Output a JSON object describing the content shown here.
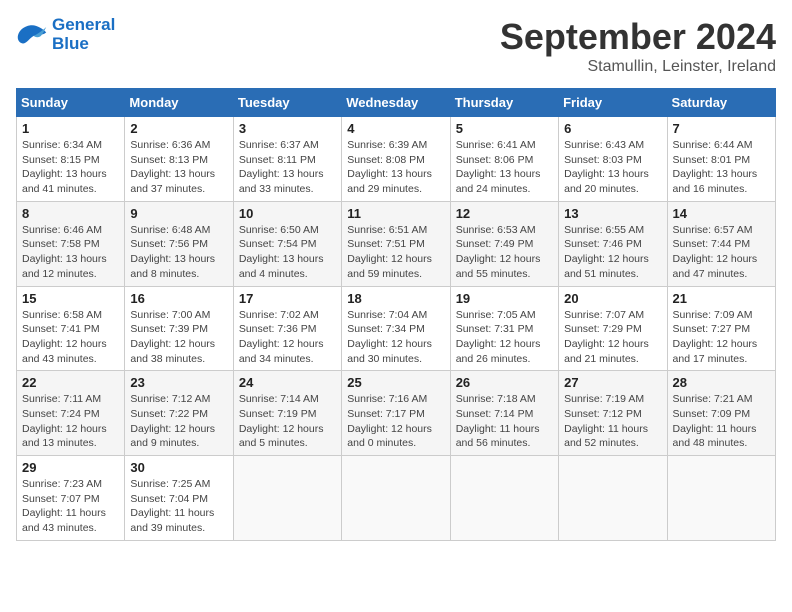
{
  "header": {
    "logo_line1": "General",
    "logo_line2": "Blue",
    "month": "September 2024",
    "location": "Stamullin, Leinster, Ireland"
  },
  "weekdays": [
    "Sunday",
    "Monday",
    "Tuesday",
    "Wednesday",
    "Thursday",
    "Friday",
    "Saturday"
  ],
  "weeks": [
    [
      {
        "num": "1",
        "rise": "6:34 AM",
        "set": "8:15 PM",
        "daylight": "13 hours and 41 minutes."
      },
      {
        "num": "2",
        "rise": "6:36 AM",
        "set": "8:13 PM",
        "daylight": "13 hours and 37 minutes."
      },
      {
        "num": "3",
        "rise": "6:37 AM",
        "set": "8:11 PM",
        "daylight": "13 hours and 33 minutes."
      },
      {
        "num": "4",
        "rise": "6:39 AM",
        "set": "8:08 PM",
        "daylight": "13 hours and 29 minutes."
      },
      {
        "num": "5",
        "rise": "6:41 AM",
        "set": "8:06 PM",
        "daylight": "13 hours and 24 minutes."
      },
      {
        "num": "6",
        "rise": "6:43 AM",
        "set": "8:03 PM",
        "daylight": "13 hours and 20 minutes."
      },
      {
        "num": "7",
        "rise": "6:44 AM",
        "set": "8:01 PM",
        "daylight": "13 hours and 16 minutes."
      }
    ],
    [
      {
        "num": "8",
        "rise": "6:46 AM",
        "set": "7:58 PM",
        "daylight": "13 hours and 12 minutes."
      },
      {
        "num": "9",
        "rise": "6:48 AM",
        "set": "7:56 PM",
        "daylight": "13 hours and 8 minutes."
      },
      {
        "num": "10",
        "rise": "6:50 AM",
        "set": "7:54 PM",
        "daylight": "13 hours and 4 minutes."
      },
      {
        "num": "11",
        "rise": "6:51 AM",
        "set": "7:51 PM",
        "daylight": "12 hours and 59 minutes."
      },
      {
        "num": "12",
        "rise": "6:53 AM",
        "set": "7:49 PM",
        "daylight": "12 hours and 55 minutes."
      },
      {
        "num": "13",
        "rise": "6:55 AM",
        "set": "7:46 PM",
        "daylight": "12 hours and 51 minutes."
      },
      {
        "num": "14",
        "rise": "6:57 AM",
        "set": "7:44 PM",
        "daylight": "12 hours and 47 minutes."
      }
    ],
    [
      {
        "num": "15",
        "rise": "6:58 AM",
        "set": "7:41 PM",
        "daylight": "12 hours and 43 minutes."
      },
      {
        "num": "16",
        "rise": "7:00 AM",
        "set": "7:39 PM",
        "daylight": "12 hours and 38 minutes."
      },
      {
        "num": "17",
        "rise": "7:02 AM",
        "set": "7:36 PM",
        "daylight": "12 hours and 34 minutes."
      },
      {
        "num": "18",
        "rise": "7:04 AM",
        "set": "7:34 PM",
        "daylight": "12 hours and 30 minutes."
      },
      {
        "num": "19",
        "rise": "7:05 AM",
        "set": "7:31 PM",
        "daylight": "12 hours and 26 minutes."
      },
      {
        "num": "20",
        "rise": "7:07 AM",
        "set": "7:29 PM",
        "daylight": "12 hours and 21 minutes."
      },
      {
        "num": "21",
        "rise": "7:09 AM",
        "set": "7:27 PM",
        "daylight": "12 hours and 17 minutes."
      }
    ],
    [
      {
        "num": "22",
        "rise": "7:11 AM",
        "set": "7:24 PM",
        "daylight": "12 hours and 13 minutes."
      },
      {
        "num": "23",
        "rise": "7:12 AM",
        "set": "7:22 PM",
        "daylight": "12 hours and 9 minutes."
      },
      {
        "num": "24",
        "rise": "7:14 AM",
        "set": "7:19 PM",
        "daylight": "12 hours and 5 minutes."
      },
      {
        "num": "25",
        "rise": "7:16 AM",
        "set": "7:17 PM",
        "daylight": "12 hours and 0 minutes."
      },
      {
        "num": "26",
        "rise": "7:18 AM",
        "set": "7:14 PM",
        "daylight": "11 hours and 56 minutes."
      },
      {
        "num": "27",
        "rise": "7:19 AM",
        "set": "7:12 PM",
        "daylight": "11 hours and 52 minutes."
      },
      {
        "num": "28",
        "rise": "7:21 AM",
        "set": "7:09 PM",
        "daylight": "11 hours and 48 minutes."
      }
    ],
    [
      {
        "num": "29",
        "rise": "7:23 AM",
        "set": "7:07 PM",
        "daylight": "11 hours and 43 minutes."
      },
      {
        "num": "30",
        "rise": "7:25 AM",
        "set": "7:04 PM",
        "daylight": "11 hours and 39 minutes."
      },
      null,
      null,
      null,
      null,
      null
    ]
  ]
}
